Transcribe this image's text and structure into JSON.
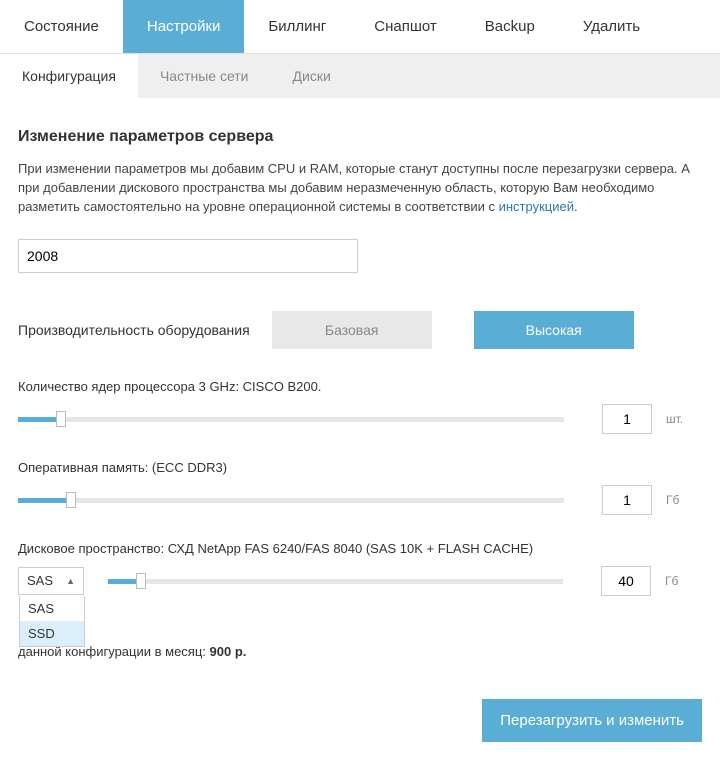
{
  "tabs": {
    "main": [
      "Состояние",
      "Настройки",
      "Биллинг",
      "Снапшот",
      "Backup",
      "Удалить"
    ],
    "main_active": 1,
    "sub": [
      "Конфигурация",
      "Частные сети",
      "Диски"
    ],
    "sub_active": 0
  },
  "heading": "Изменение параметров сервера",
  "desc_a": "При изменении параметров мы добавим CPU и RAM, которые станут доступны после перезагрузки сервера. А при добавлении дискового пространства мы добавим неразмеченную область, которую Вам необходимо разметить самостоятельно на уровне операционной системы в соответствии с ",
  "desc_link": "инструкцией",
  "desc_b": ".",
  "server_name": "2008",
  "perf": {
    "label": "Производительность оборудования",
    "base": "Базовая",
    "high": "Высокая"
  },
  "cpu": {
    "label": "Количество ядер процессора 3 GHz: CISCO B200.",
    "value": "1",
    "unit": "шт."
  },
  "ram": {
    "label": "Оперативная память: (ECC DDR3)",
    "value": "1",
    "unit": "Гб"
  },
  "disk": {
    "label": "Дисковое пространство: СХД NetApp FAS 6240/FAS 8040 (SAS 10K + FLASH CACHE)",
    "selected": "SAS",
    "options": [
      "SAS",
      "SSD"
    ],
    "value": "40",
    "unit": "Гб"
  },
  "price": {
    "prefix": "данной конфигурации в месяц: ",
    "value": "900 р."
  },
  "submit": "Перезагрузить и изменить"
}
